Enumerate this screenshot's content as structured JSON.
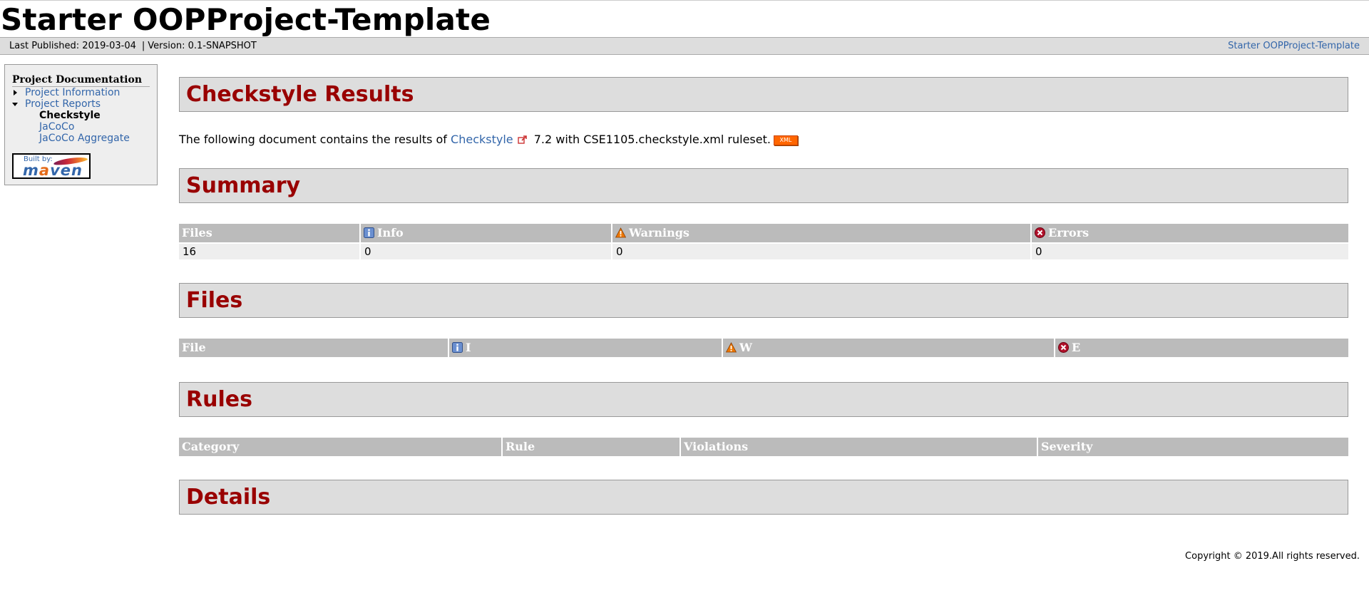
{
  "banner": {
    "title": "Starter OOPProject-Template"
  },
  "breadcrumbs": {
    "published": "Last Published: 2019-03-04",
    "separator": "|",
    "version": "Version: 0.1-SNAPSHOT",
    "right_link": "Starter OOPProject-Template"
  },
  "sidebar": {
    "heading": "Project Documentation",
    "items": [
      {
        "label": "Project Information",
        "expanded": false
      },
      {
        "label": "Project Reports",
        "expanded": true,
        "children": [
          "Checkstyle",
          "JaCoCo",
          "JaCoCo Aggregate"
        ]
      }
    ],
    "powered_by": {
      "built_by": "Built by:",
      "maven_pre": "m",
      "maven_a": "a",
      "maven_post": "ven"
    }
  },
  "main": {
    "title": "Checkstyle Results",
    "intro": {
      "prefix": "The following document contains the results of ",
      "link": "Checkstyle",
      "suffix": " 7.2 with CSE1105.checkstyle.xml ruleset.",
      "xml_badge": "XML"
    },
    "summary": {
      "heading": "Summary",
      "columns": [
        "Files",
        "Info",
        "Warnings",
        "Errors"
      ],
      "row": [
        "16",
        "0",
        "0",
        "0"
      ]
    },
    "files": {
      "heading": "Files",
      "columns": [
        "File",
        "I",
        "W",
        "E"
      ]
    },
    "rules": {
      "heading": "Rules",
      "columns": [
        "Category",
        "Rule",
        "Violations",
        "Severity"
      ]
    },
    "details": {
      "heading": "Details"
    }
  },
  "footer": {
    "copyright": "Copyright © 2019.All rights reserved."
  },
  "colors": {
    "heading_red": "#990000",
    "link_blue": "#3366aa",
    "header_gray": "#bbbbbb",
    "section_gray": "#dddddd"
  }
}
